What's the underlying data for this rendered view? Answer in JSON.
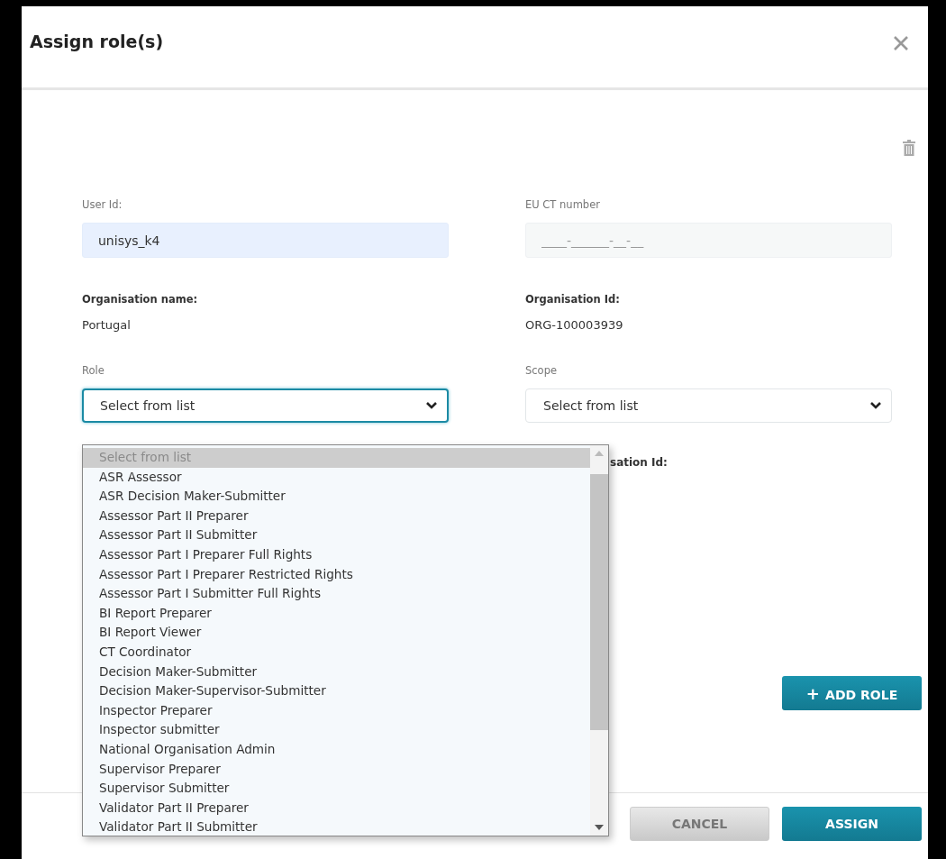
{
  "dialog": {
    "title": "Assign role(s)"
  },
  "fields": {
    "user_id": {
      "label": "User Id:",
      "value": "unisys_k4"
    },
    "eu_ct_number": {
      "label": "EU CT number",
      "placeholder": "____-______-__-__"
    },
    "organisation_name": {
      "label": "Organisation name:",
      "value": "Portugal"
    },
    "organisation_id": {
      "label": "Organisation Id:",
      "value": "ORG-100003939"
    },
    "role": {
      "label": "Role",
      "value": "Select from list",
      "focused": true
    },
    "scope": {
      "label": "Scope",
      "value": "Select from list",
      "focused": false
    },
    "partial_label": "sation Id:"
  },
  "role_options": [
    {
      "label": "Select from list",
      "selected": true,
      "disabled": true
    },
    {
      "label": "ASR Assessor",
      "selected": false,
      "disabled": false
    },
    {
      "label": "ASR Decision Maker-Submitter",
      "selected": false,
      "disabled": false
    },
    {
      "label": "Assessor Part II Preparer",
      "selected": false,
      "disabled": false
    },
    {
      "label": "Assessor Part II Submitter",
      "selected": false,
      "disabled": false
    },
    {
      "label": "Assessor Part I Preparer Full Rights",
      "selected": false,
      "disabled": false
    },
    {
      "label": "Assessor Part I Preparer Restricted Rights",
      "selected": false,
      "disabled": false
    },
    {
      "label": "Assessor Part I Submitter Full Rights",
      "selected": false,
      "disabled": false
    },
    {
      "label": "BI Report Preparer",
      "selected": false,
      "disabled": false
    },
    {
      "label": "BI Report Viewer",
      "selected": false,
      "disabled": false
    },
    {
      "label": "CT Coordinator",
      "selected": false,
      "disabled": false
    },
    {
      "label": "Decision Maker-Submitter",
      "selected": false,
      "disabled": false
    },
    {
      "label": "Decision Maker-Supervisor-Submitter",
      "selected": false,
      "disabled": false
    },
    {
      "label": "Inspector Preparer",
      "selected": false,
      "disabled": false
    },
    {
      "label": "Inspector submitter",
      "selected": false,
      "disabled": false
    },
    {
      "label": "National Organisation Admin",
      "selected": false,
      "disabled": false
    },
    {
      "label": "Supervisor Preparer",
      "selected": false,
      "disabled": false
    },
    {
      "label": "Supervisor Submitter",
      "selected": false,
      "disabled": false
    },
    {
      "label": "Validator Part II Preparer",
      "selected": false,
      "disabled": false
    },
    {
      "label": "Validator Part II Submitter",
      "selected": false,
      "disabled": false
    }
  ],
  "add_role_button": {
    "icon": "+",
    "label": "ADD ROLE"
  },
  "buttons": [
    {
      "label": "CANCEL",
      "kind": "secondary"
    },
    {
      "label": "ASSIGN",
      "kind": "primary"
    }
  ]
}
